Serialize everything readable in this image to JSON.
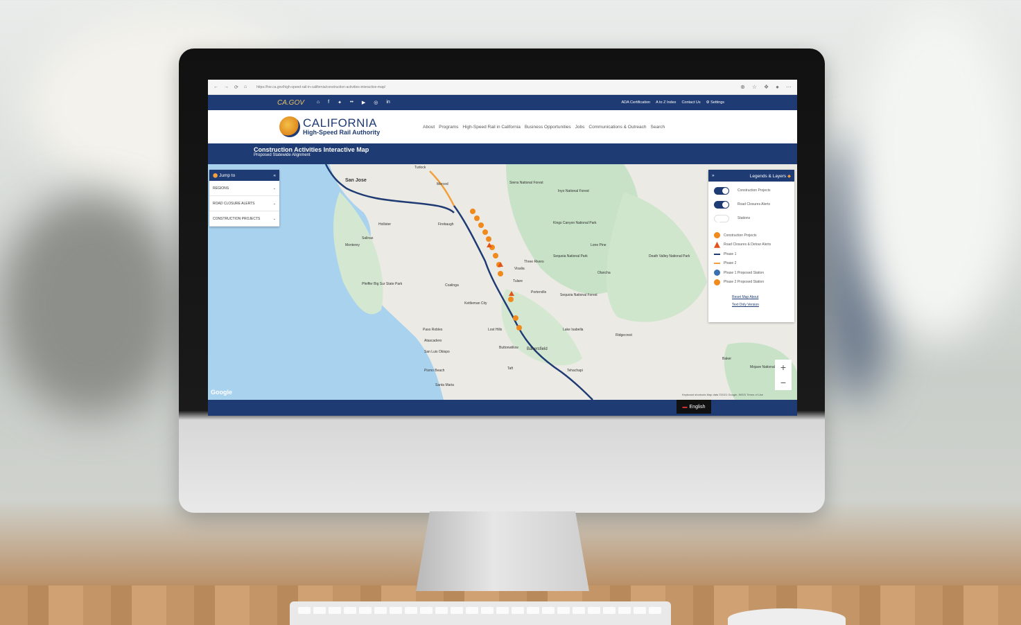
{
  "browser": {
    "url": "https://hsr.ca.gov/high-speed-rail-in-california/construction-activities-interactive-map/"
  },
  "utility_bar": {
    "cagov": "CA.GOV",
    "links": [
      "ADA Certification",
      "A to Z Index",
      "Contact Us",
      "Settings"
    ]
  },
  "header": {
    "logo_line1": "CALIFORNIA",
    "logo_line2": "High-Speed Rail Authority",
    "nav": [
      "About",
      "Programs",
      "High-Speed Rail in California",
      "Business Opportunities",
      "Jobs",
      "Communications & Outreach",
      "Search"
    ]
  },
  "page": {
    "title": "Construction Activities Interactive Map",
    "subtitle": "Proposed Statewide Alignment"
  },
  "jump_panel": {
    "title": "Jump to",
    "items": [
      "REGIONS",
      "ROAD CLOSURE ALERTS",
      "CONSTRUCTION PROJECTS"
    ]
  },
  "legend_panel": {
    "title": "Legends & Layers",
    "toggles": [
      {
        "label": "Construction Projects",
        "on": true
      },
      {
        "label": "Road Closures Alerts",
        "on": true
      },
      {
        "label": "Stations",
        "on": false
      }
    ],
    "legend": [
      {
        "label": "Construction Projects",
        "color": "#f08a1c"
      },
      {
        "label": "Road Closures & Detour Alerts",
        "color": "#e2531c"
      },
      {
        "label": "Phase 1",
        "color": "#1f3b73"
      },
      {
        "label": "Phase 2",
        "color": "#f2a03d"
      },
      {
        "label": "Phase 1 Proposed Station",
        "color": "#3a6fb0"
      },
      {
        "label": "Phase 2 Proposed Station",
        "color": "#f08a1c"
      }
    ],
    "links": [
      "Reset Map",
      "About",
      "Text Only Version"
    ]
  },
  "map": {
    "labels": [
      {
        "text": "San Jose"
      },
      {
        "text": "Turlock"
      },
      {
        "text": "Merced"
      },
      {
        "text": "Salinas"
      },
      {
        "text": "Monterey"
      },
      {
        "text": "Hollister"
      },
      {
        "text": "Firebaugh"
      },
      {
        "text": "Visalia"
      },
      {
        "text": "Tulare"
      },
      {
        "text": "Porterville"
      },
      {
        "text": "Coalinga"
      },
      {
        "text": "Kettleman City"
      },
      {
        "text": "Paso Robles"
      },
      {
        "text": "Atascadero"
      },
      {
        "text": "San Luis Obispo"
      },
      {
        "text": "Pismo Beach"
      },
      {
        "text": "Santa Maria"
      },
      {
        "text": "Lost Hills"
      },
      {
        "text": "Buttonwillow"
      },
      {
        "text": "Bakersfield"
      },
      {
        "text": "Taft"
      },
      {
        "text": "Tehachapi"
      },
      {
        "text": "Sierra National Forest"
      },
      {
        "text": "Inyo National Forest"
      },
      {
        "text": "Kings Canyon National Park"
      },
      {
        "text": "Sequoia National Park"
      },
      {
        "text": "Sequoia National Forest"
      },
      {
        "text": "Death Valley National Park"
      },
      {
        "text": "Lake Isabella"
      },
      {
        "text": "Mojave National Preserve"
      },
      {
        "text": "Pfeiffer Big Sur State Park"
      },
      {
        "text": "Three Rivers"
      },
      {
        "text": "Lone Pine"
      },
      {
        "text": "Olancha"
      },
      {
        "text": "Ridgecrest"
      },
      {
        "text": "Baker"
      }
    ],
    "google": "Google",
    "attribution": "Keyboard shortcuts  Map data ©2021 Google, INEGI  Terms of Use",
    "zoom_in": "+",
    "zoom_out": "−"
  },
  "footer": {
    "language": "English"
  }
}
